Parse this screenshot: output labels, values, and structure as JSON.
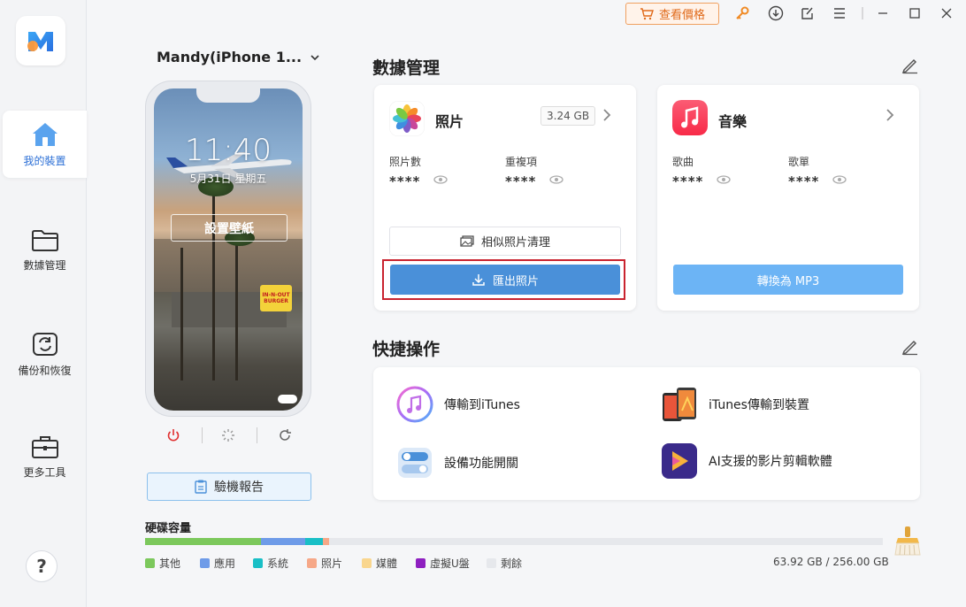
{
  "titlebar": {
    "price_label": "查看價格",
    "icons": [
      "cart-icon",
      "key-icon",
      "download-icon",
      "feedback-icon",
      "menu-icon",
      "minimize-icon",
      "maximize-icon",
      "close-icon"
    ]
  },
  "sidebar": {
    "logo": "M",
    "items": [
      {
        "label": "我的裝置",
        "icon": "home-icon",
        "active": true
      },
      {
        "label": "數據管理",
        "icon": "folder-icon",
        "active": false
      },
      {
        "label": "備份和恢復",
        "icon": "backup-icon",
        "active": false
      },
      {
        "label": "更多工具",
        "icon": "toolbox-icon",
        "active": false
      }
    ],
    "help": "?"
  },
  "device": {
    "name": "Mandy(iPhone 1...",
    "time": "11:40",
    "date": "5月31日 星期五",
    "wallpaper_button": "設置壁紙",
    "report_button": "驗機報告",
    "sign_text": "IN-N-OUT BURGER"
  },
  "data_management": {
    "title": "數據管理",
    "photos": {
      "title": "照片",
      "size": "3.24 GB",
      "stat1_label": "照片數",
      "stat1_value": "****",
      "stat2_label": "重複項",
      "stat2_value": "****",
      "clean_button": "相似照片清理",
      "export_button": "匯出照片"
    },
    "music": {
      "title": "音樂",
      "stat1_label": "歌曲",
      "stat1_value": "****",
      "stat2_label": "歌單",
      "stat2_value": "****",
      "convert_button": "轉換為 MP3"
    }
  },
  "quick_actions": {
    "title": "快捷操作",
    "items": [
      {
        "label": "傳輸到iTunes",
        "icon": "itunes-icon"
      },
      {
        "label": "iTunes傳輸到裝置",
        "icon": "itunes-to-device-icon"
      },
      {
        "label": "設備功能開關",
        "icon": "toggle-icon"
      },
      {
        "label": "AI支援的影片剪輯軟體",
        "icon": "video-editor-icon"
      }
    ]
  },
  "storage": {
    "title": "硬碟容量",
    "legend": [
      {
        "label": "其他",
        "color": "#7cc85c"
      },
      {
        "label": "應用",
        "color": "#6e9be8"
      },
      {
        "label": "系統",
        "color": "#19bfc6"
      },
      {
        "label": "照片",
        "color": "#f6a888"
      },
      {
        "label": "媒體",
        "color": "#f9d68e"
      },
      {
        "label": "虛擬U盤",
        "color": "#8e1fc0"
      },
      {
        "label": "剩餘",
        "color": "#e6e8ec"
      }
    ],
    "usage_fractions": [
      0.157,
      0.06,
      0.024,
      0.009,
      0,
      0,
      0.75
    ],
    "total": "63.92 GB / 256.00 GB"
  }
}
